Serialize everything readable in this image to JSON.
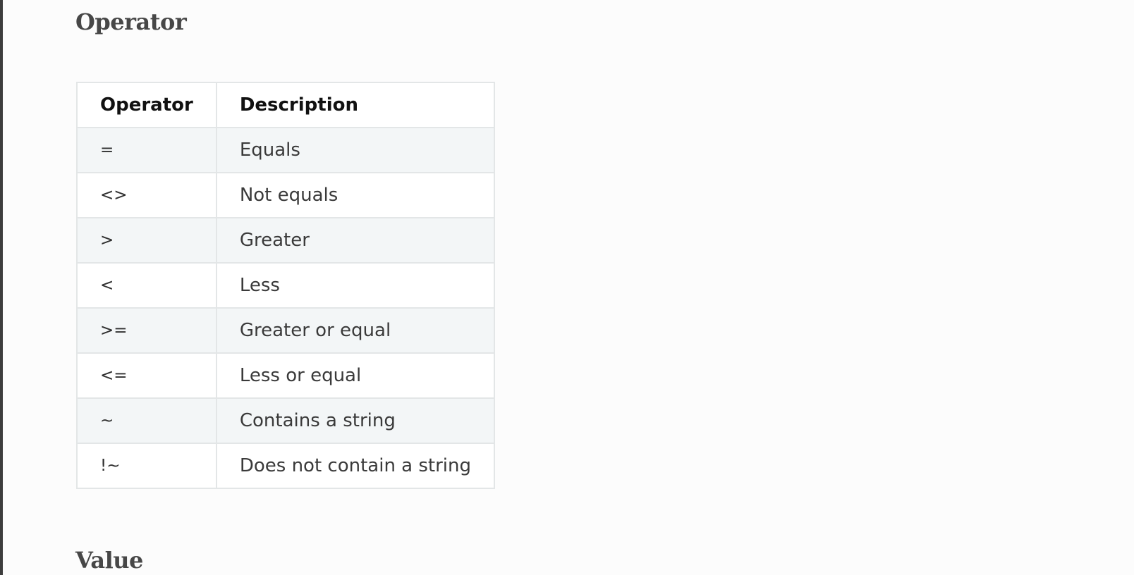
{
  "headings": {
    "operator": "Operator",
    "value": "Value"
  },
  "table": {
    "columns": [
      "Operator",
      "Description"
    ],
    "rows": [
      {
        "operator": "=",
        "description": "Equals"
      },
      {
        "operator": "<>",
        "description": "Not equals"
      },
      {
        "operator": ">",
        "description": "Greater"
      },
      {
        "operator": "<",
        "description": "Less"
      },
      {
        "operator": ">=",
        "description": "Greater or equal"
      },
      {
        "operator": "<=",
        "description": "Less or equal"
      },
      {
        "operator": "~",
        "description": "Contains a string"
      },
      {
        "operator": "!~",
        "description": "Does not contain a string"
      }
    ]
  },
  "colors": {
    "background": "#fcfcfc",
    "stripe": "#f3f6f7",
    "border": "#e3e6e7",
    "heading": "#474747",
    "left_bar": "#3d3d3d"
  }
}
